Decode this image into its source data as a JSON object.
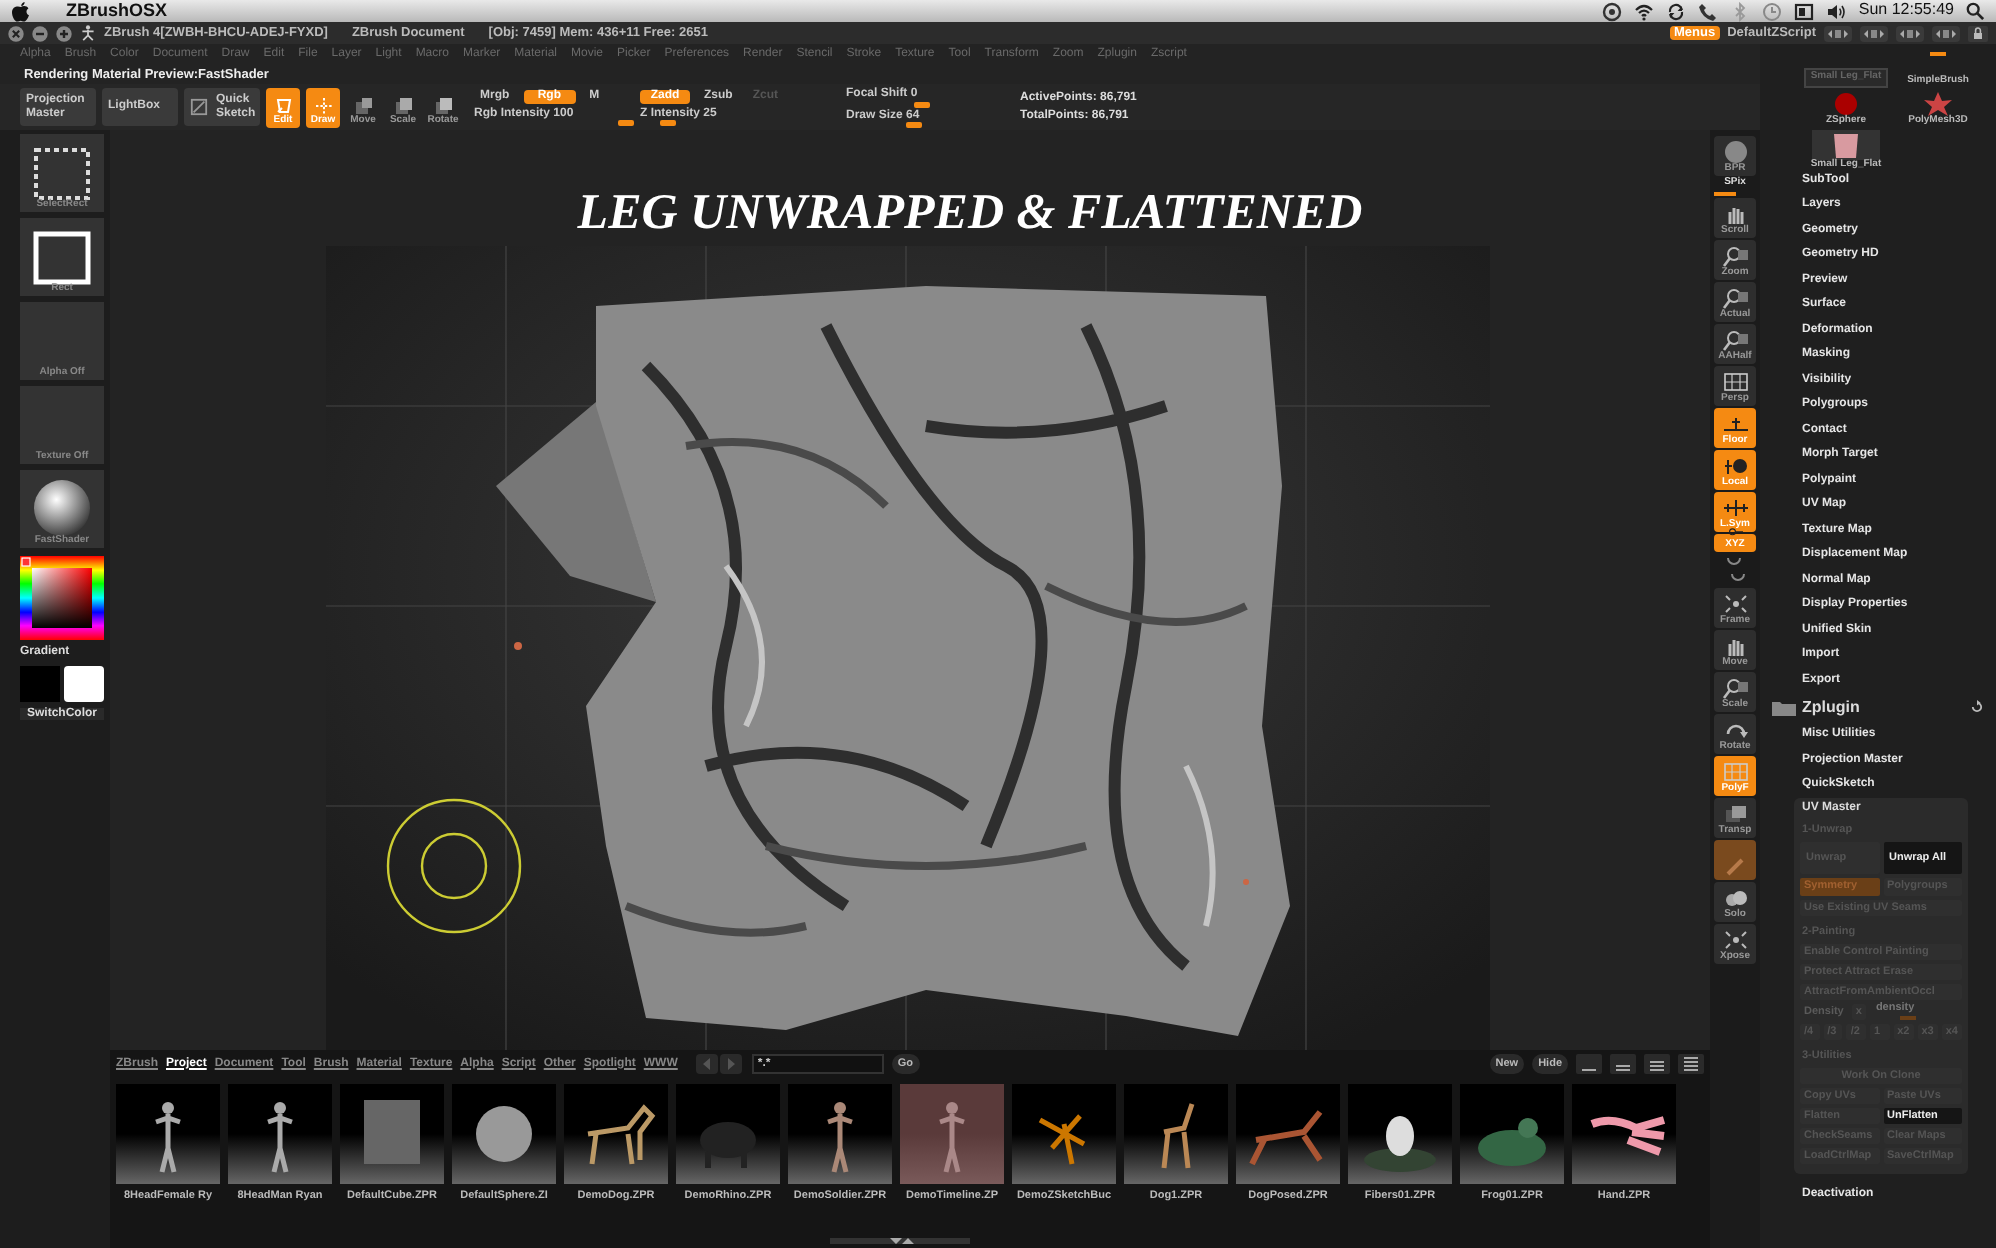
{
  "os_menubar": {
    "app": "ZBrushOSX",
    "clock": "Sun 12:55:49"
  },
  "title_bar": {
    "title": "ZBrush 4[ZWBH-BHCU-ADEJ-FYXD]",
    "document": "ZBrush Document",
    "stats": "[Obj: 7459] Mem: 436+11 Free: 2651",
    "menus": {
      "label": "Menus",
      "on": true
    },
    "script": "DefaultZScript"
  },
  "menu_bar": [
    "Alpha",
    "Brush",
    "Color",
    "Document",
    "Draw",
    "Edit",
    "File",
    "Layer",
    "Light",
    "Macro",
    "Marker",
    "Material",
    "Movie",
    "Picker",
    "Preferences",
    "Render",
    "Stencil",
    "Stroke",
    "Texture",
    "Tool",
    "Transform",
    "Zoom",
    "Zplugin",
    "Zscript"
  ],
  "status": "Rendering Material Preview:FastShader",
  "toolbar": {
    "buttons": [
      {
        "label": "Projection Master",
        "kind": "wide",
        "on": false
      },
      {
        "label": "LightBox",
        "kind": "wide",
        "on": false
      },
      {
        "label": "Quick Sketch",
        "kind": "sketch",
        "on": false
      },
      {
        "label": "Edit",
        "kind": "edit",
        "on": true
      },
      {
        "label": "Draw",
        "kind": "draw",
        "on": true
      },
      {
        "label": "Move",
        "kind": "move",
        "on": false
      },
      {
        "label": "Scale",
        "kind": "scale",
        "on": false
      },
      {
        "label": "Rotate",
        "kind": "rotate",
        "on": false
      }
    ],
    "color_modes": [
      {
        "label": "Mrgb",
        "on": false
      },
      {
        "label": "Rgb",
        "on": true
      },
      {
        "label": "M",
        "on": false
      }
    ],
    "rgb_intensity": {
      "label": "Rgb Intensity 100",
      "level": 1.0
    },
    "z_modes": [
      {
        "label": "Zadd",
        "on": true,
        "disabled": false
      },
      {
        "label": "Zsub",
        "on": false,
        "disabled": false
      },
      {
        "label": "Zcut",
        "on": false,
        "disabled": true
      }
    ],
    "z_intensity": {
      "label": "Z Intensity 25",
      "level": 0.25
    },
    "focal_shift": {
      "label": "Focal Shift 0",
      "level": 0.5
    },
    "draw_size": {
      "label": "Draw Size 64",
      "level": 0.45
    },
    "points": [
      "ActivePoints: 86,791",
      "TotalPoints: 86,791"
    ]
  },
  "left_shelf": [
    {
      "label": "SelectRect",
      "kind": "selectrect"
    },
    {
      "label": "Rect",
      "kind": "rect"
    },
    {
      "label": "Alpha Off",
      "kind": "blank"
    },
    {
      "label": "Texture Off",
      "kind": "blank"
    },
    {
      "label": "FastShader",
      "kind": "sphere"
    }
  ],
  "color": {
    "gradient": "Gradient",
    "switch": "SwitchColor"
  },
  "canvas": {
    "title": "LEG UNWRAPPED & FLATTENED"
  },
  "right_shelf": [
    {
      "label": "BPR",
      "kind": "sphere",
      "on": false
    },
    {
      "label": "SPix",
      "kind": "slider",
      "level": 0.5
    },
    {
      "label": "Scroll",
      "kind": "hand",
      "on": false
    },
    {
      "label": "Zoom",
      "kind": "magnifier",
      "on": false
    },
    {
      "label": "Actual",
      "kind": "magnifier",
      "on": false
    },
    {
      "label": "AAHalf",
      "kind": "magnifier",
      "on": false
    },
    {
      "label": "Persp",
      "kind": "grid",
      "on": false
    },
    {
      "label": "Floor",
      "kind": "floor",
      "on": true
    },
    {
      "label": "Local",
      "kind": "local",
      "on": true
    },
    {
      "label": "L.Sym",
      "kind": "sym",
      "on": true
    },
    {
      "label": "XYZ",
      "kind": "xyz",
      "on": true
    },
    {
      "kind": "small",
      "on": false
    },
    {
      "label": "Frame",
      "kind": "frame",
      "on": false
    },
    {
      "label": "Move",
      "kind": "hand",
      "on": false
    },
    {
      "label": "Scale",
      "kind": "magnifier",
      "on": false
    },
    {
      "label": "Rotate",
      "kind": "rotate",
      "on": false
    },
    {
      "label": "PolyF",
      "kind": "grid",
      "on": true
    },
    {
      "label": "Transp",
      "kind": "layers",
      "on": false
    },
    {
      "kind": "brush",
      "on": true
    },
    {
      "label": "Solo",
      "kind": "cloud",
      "on": false
    },
    {
      "label": "Xpose",
      "kind": "frame",
      "on": false
    }
  ],
  "palette": {
    "tools": [
      {
        "label": "Small Leg_Flat",
        "kind": "blank"
      },
      {
        "label": "SimpleBrush",
        "kind": "brush"
      },
      {
        "label": "ZSphere",
        "kind": "zsphere"
      },
      {
        "label": "PolyMesh3D",
        "kind": "star"
      },
      {
        "label": "Small Leg_Flat",
        "kind": "mesh"
      }
    ],
    "items": [
      "SubTool",
      "Layers",
      "Geometry",
      "Geometry HD",
      "Preview",
      "Surface",
      "Deformation",
      "Masking",
      "Visibility",
      "Polygroups",
      "Contact",
      "Morph Target",
      "Polypaint",
      "UV Map",
      "Texture Map",
      "Displacement Map",
      "Normal Map",
      "Display Properties",
      "Unified Skin",
      "Import",
      "Export"
    ],
    "zplugin": {
      "title": "Zplugin",
      "items": [
        "Misc Utilities",
        "Projection Master",
        "QuickSketch"
      ]
    },
    "uv_master": {
      "title": "UV Master",
      "sections": [
        {
          "heading": "1-Unwrap",
          "rows": [
            [
              {
                "label": "Unwrap",
                "on": false,
                "disabled": true
              },
              {
                "label": "Unwrap All",
                "on": false,
                "disabled": false
              }
            ],
            [
              {
                "label": "Symmetry",
                "on": true,
                "disabled": true
              },
              {
                "label": "Polygroups",
                "on": false,
                "disabled": true
              }
            ],
            [
              {
                "label": "Use Existing UV Seams",
                "on": false,
                "disabled": true
              }
            ]
          ]
        },
        {
          "heading": "2-Painting",
          "rows": [
            [
              {
                "label": "Enable Control Painting",
                "on": false,
                "disabled": true
              }
            ],
            [
              {
                "label": "Protect Attract Erase",
                "on": false,
                "disabled": true
              }
            ],
            [
              {
                "label": "AttractFromAmbientOccl",
                "on": false,
                "disabled": true
              }
            ],
            {
              "label": "Density",
              "multiplier": "x",
              "slider_label": "density",
              "level": 0.4,
              "disabled": true
            },
            [
              {
                "label": "/4",
                "on": false,
                "disabled": true
              },
              {
                "label": "/3",
                "on": false,
                "disabled": true
              },
              {
                "label": "/2",
                "on": false,
                "disabled": true
              },
              {
                "label": "1",
                "on": false,
                "disabled": true
              },
              {
                "label": "x2",
                "on": false,
                "disabled": true
              },
              {
                "label": "x3",
                "on": false,
                "disabled": true
              },
              {
                "label": "x4",
                "on": false,
                "disabled": true
              }
            ]
          ]
        },
        {
          "heading": "3-Utilities",
          "rows": [
            [
              {
                "label": "Work On Clone",
                "on": false,
                "disabled": true
              }
            ],
            [
              {
                "label": "Copy UVs",
                "on": false,
                "disabled": true
              },
              {
                "label": "Paste UVs",
                "on": false,
                "disabled": true
              }
            ],
            [
              {
                "label": "Flatten",
                "on": false,
                "disabled": true
              },
              {
                "label": "UnFlatten",
                "on": false,
                "disabled": false
              }
            ],
            [
              {
                "label": "CheckSeams",
                "on": false,
                "disabled": true
              },
              {
                "label": "Clear Maps",
                "on": false,
                "disabled": true
              }
            ],
            [
              {
                "label": "LoadCtrlMap",
                "on": false,
                "disabled": true
              },
              {
                "label": "SaveCtrlMap",
                "on": false,
                "disabled": true
              }
            ]
          ]
        }
      ]
    },
    "deactivation": "Deactivation"
  },
  "lightbox": {
    "tabs": [
      {
        "label": "ZBrush",
        "selected": false
      },
      {
        "label": "Project",
        "selected": true
      },
      {
        "label": "Document",
        "selected": false
      },
      {
        "label": "Tool",
        "selected": false
      },
      {
        "label": "Brush",
        "selected": false
      },
      {
        "label": "Material",
        "selected": false
      },
      {
        "label": "Texture",
        "selected": false
      },
      {
        "label": "Alpha",
        "selected": false
      },
      {
        "label": "Script",
        "selected": false
      },
      {
        "label": "Other",
        "selected": false
      },
      {
        "label": "Spotlight",
        "selected": false
      },
      {
        "label": "WWW",
        "selected": false
      }
    ],
    "filter": "*.*",
    "go": "Go",
    "new": "New",
    "hide": "Hide",
    "items": [
      {
        "label": "8HeadFemale Ry",
        "selected": false
      },
      {
        "label": "8HeadMan Ryan",
        "selected": false
      },
      {
        "label": "DefaultCube.ZPR",
        "selected": false
      },
      {
        "label": "DefaultSphere.ZI",
        "selected": false
      },
      {
        "label": "DemoDog.ZPR",
        "selected": false
      },
      {
        "label": "DemoRhino.ZPR",
        "selected": false
      },
      {
        "label": "DemoSoldier.ZPR",
        "selected": false
      },
      {
        "label": "DemoTimeline.ZP",
        "selected": true
      },
      {
        "label": "DemoZSketchBuc",
        "selected": false
      },
      {
        "label": "Dog1.ZPR",
        "selected": false
      },
      {
        "label": "DogPosed.ZPR",
        "selected": false
      },
      {
        "label": "Fibers01.ZPR",
        "selected": false
      },
      {
        "label": "Frog01.ZPR",
        "selected": false
      },
      {
        "label": "Hand.ZPR",
        "selected": false
      }
    ]
  }
}
